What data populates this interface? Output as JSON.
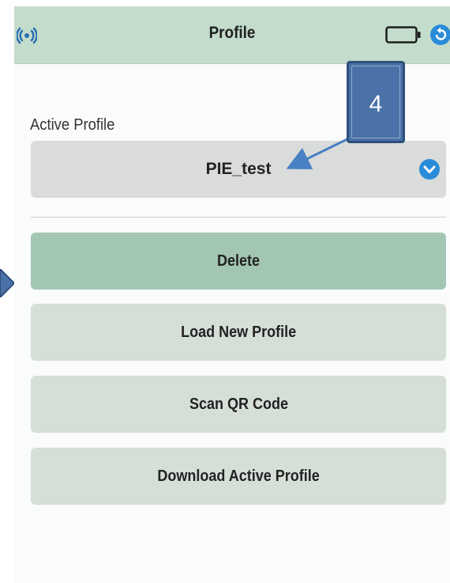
{
  "header": {
    "title": "Profile",
    "left_icon": "nfc-signal-icon",
    "battery_icon": "battery-icon",
    "back_icon": "back-icon"
  },
  "active_profile": {
    "label": "Active Profile",
    "selected_value": "PIE_test",
    "dropdown_icon": "chevron-down-icon"
  },
  "buttons": {
    "delete": "Delete",
    "load_new_profile": "Load New Profile",
    "scan_qr_code": "Scan QR Code",
    "download_active_profile": "Download Active Profile"
  },
  "callout": {
    "number": "4"
  },
  "colors": {
    "header_bg": "#c3dccb",
    "primary_button": "#a3c6b2",
    "secondary_button": "#d5dfd8",
    "select_bg": "#d9dcda",
    "accent_blue": "#2a8bd8",
    "callout_blue": "#4a72a8"
  }
}
